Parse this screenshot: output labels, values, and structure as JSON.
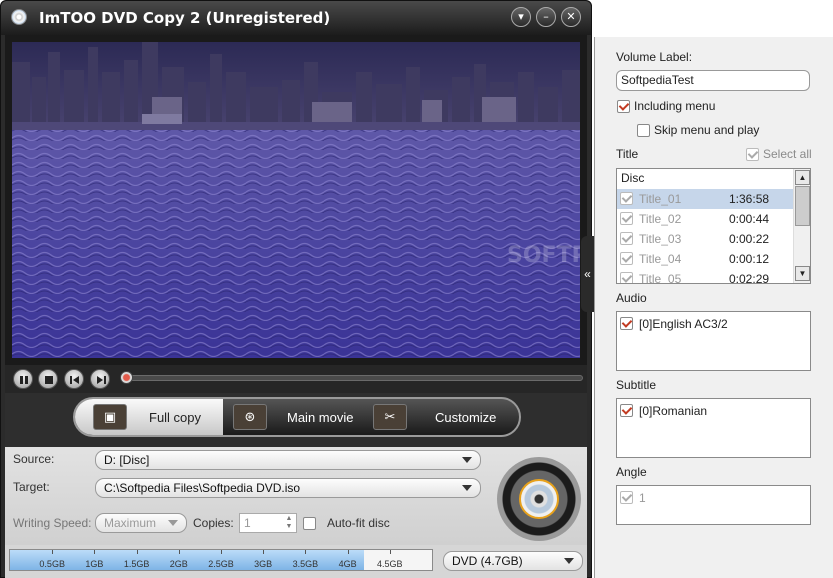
{
  "window": {
    "title": "ImTOO DVD Copy 2 (Unregistered)",
    "buttons": {
      "dropdown": "▾",
      "minimize": "–",
      "close": "✕"
    }
  },
  "playback": {
    "icons": [
      "pause-icon",
      "stop-icon",
      "prev-icon",
      "next-icon"
    ],
    "progress": 0
  },
  "modes": [
    {
      "label": "Full copy",
      "active": true,
      "icon": "full-copy-icon"
    },
    {
      "label": "Main movie",
      "active": false,
      "icon": "film-reel-icon"
    },
    {
      "label": "Customize",
      "active": false,
      "icon": "tools-icon"
    }
  ],
  "settings": {
    "source_label": "Source:",
    "source_value": "D: [Disc]",
    "target_label": "Target:",
    "target_value": "C:\\Softpedia Files\\Softpedia DVD.iso",
    "writing_speed_label": "Writing Speed:",
    "writing_speed_value": "Maximum",
    "copies_label": "Copies:",
    "copies_value": "1",
    "autofit_label": "Auto-fit disc",
    "autofit_checked": false
  },
  "capacity": {
    "ticks": [
      "0.5GB",
      "1GB",
      "1.5GB",
      "2GB",
      "2.5GB",
      "3GB",
      "3.5GB",
      "4GB",
      "4.5GB"
    ],
    "used_fraction": 0.84,
    "disc_type": "DVD (4.7GB)"
  },
  "panel": {
    "volume_label_caption": "Volume Label:",
    "volume_label_value": "SoftpediaTest",
    "including_menu": "Including menu",
    "including_menu_checked": true,
    "skip_menu": "Skip menu and play",
    "skip_menu_checked": false,
    "title_caption": "Title",
    "select_all": "Select all",
    "disc_header": "Disc",
    "titles": [
      {
        "name": "Title_01",
        "duration": "1:36:58",
        "selected": true
      },
      {
        "name": "Title_02",
        "duration": "0:00:44",
        "selected": false
      },
      {
        "name": "Title_03",
        "duration": "0:00:22",
        "selected": false
      },
      {
        "name": "Title_04",
        "duration": "0:00:12",
        "selected": false
      },
      {
        "name": "Title_05",
        "duration": "0:02:29",
        "selected": false
      }
    ],
    "audio_caption": "Audio",
    "audio_items": [
      "[0]English AC3/2"
    ],
    "subtitle_caption": "Subtitle",
    "subtitle_items": [
      "[0]Romanian"
    ],
    "angle_caption": "Angle",
    "angle_items": [
      "1"
    ],
    "collapse_glyph": "«"
  },
  "colors": {
    "accent": "#c23b22",
    "chrome": "#2b2b2b",
    "capacity_fill": "#7eb4e6"
  }
}
